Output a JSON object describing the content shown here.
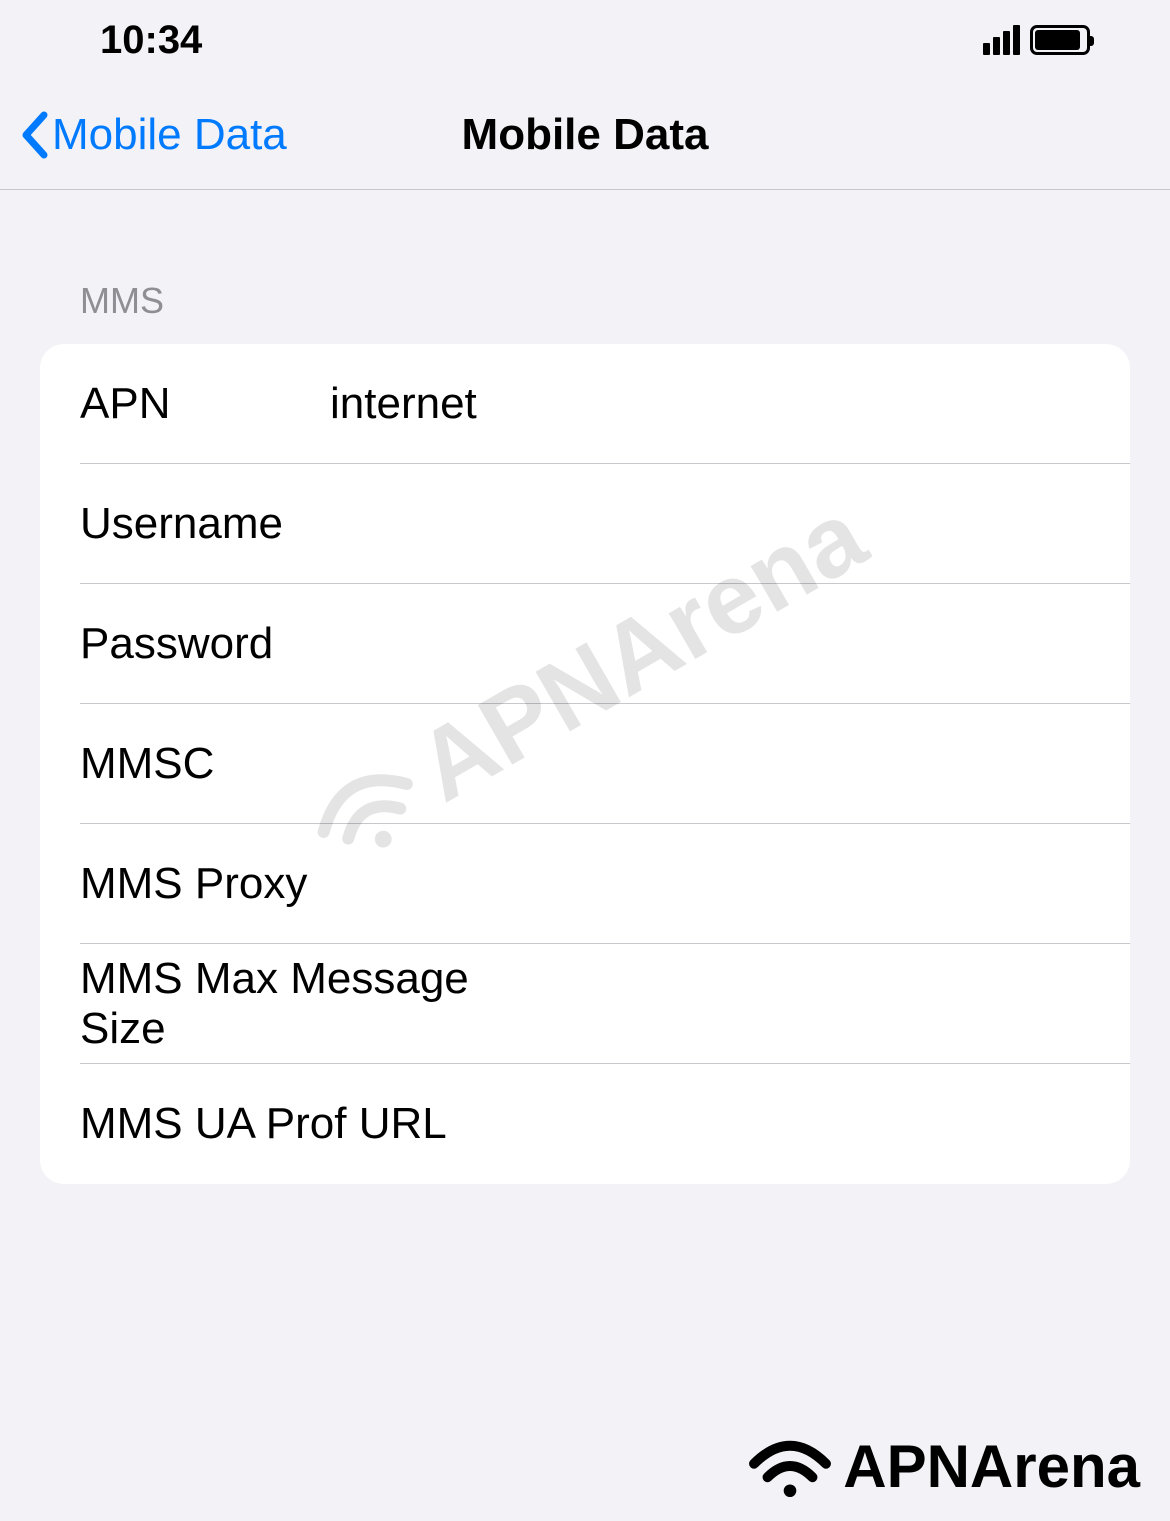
{
  "statusBar": {
    "time": "10:34"
  },
  "nav": {
    "backLabel": "Mobile Data",
    "title": "Mobile Data"
  },
  "section": {
    "header": "MMS",
    "rows": {
      "apn": {
        "label": "APN",
        "value": "internet"
      },
      "username": {
        "label": "Username",
        "value": ""
      },
      "password": {
        "label": "Password",
        "value": ""
      },
      "mmsc": {
        "label": "MMSC",
        "value": ""
      },
      "mmsProxy": {
        "label": "MMS Proxy",
        "value": ""
      },
      "mmsMaxSize": {
        "label": "MMS Max Message Size",
        "value": ""
      },
      "mmsUaProfUrl": {
        "label": "MMS UA Prof URL",
        "value": ""
      }
    }
  },
  "watermark": {
    "text": "APNArena"
  }
}
